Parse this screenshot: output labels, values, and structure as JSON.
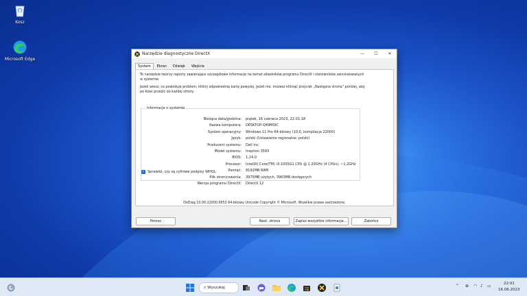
{
  "desktop": {
    "icons": [
      {
        "label": "Kosz"
      },
      {
        "label": "Microsoft Edge"
      }
    ]
  },
  "window": {
    "title": "Narzędzie diagnostyczne DirectX",
    "controls": {
      "minimize": "—",
      "maximize": "☐",
      "close": "✕"
    },
    "tabs": [
      {
        "label": "System",
        "active": true
      },
      {
        "label": "Ekran",
        "active": false
      },
      {
        "label": "Dźwięk",
        "active": false
      },
      {
        "label": "Wejście",
        "active": false
      }
    ],
    "intro_line1": "To narzędzie tworzy raporty zawierające szczegółowe informacje na temat składników programu DirectX i sterowników zainstalowanych w systemie.",
    "intro_line2": "Jeżeli wiesz, co powoduje problem, kliknij odpowiednią kartę powyżej. Jeżeli nie, możesz kliknąć przycisk „Następna strona” poniżej, aby po kolei przejść do każdej strony.",
    "group_title": "Informacje o systemie",
    "info": [
      {
        "key": "Bieżąca data/godzina:",
        "value": "piątek, 16 czerwca 2023, 22:01:18"
      },
      {
        "key": "Nazwa komputera:",
        "value": "DESKTOP-Q49MSIC"
      },
      {
        "key": "System operacyjny:",
        "value": "Windows 11 Pro 64-bitowy (10.0, kompilacja 22000)"
      },
      {
        "key": "Język:",
        "value": "polski (Ustawienie regionalne: polski)"
      },
      {
        "key": "Producent systemu:",
        "value": "Dell Inc."
      },
      {
        "key": "Model systemu:",
        "value": "Inspiron 3593"
      },
      {
        "key": "BIOS:",
        "value": "1.24.0"
      },
      {
        "key": "Procesor:",
        "value": "Intel(R) Core(TM) i3-1005G1 CPU @ 1.20GHz (4 CPUs), ~1.2GHz"
      },
      {
        "key": "Pamięć:",
        "value": "8192MB RAM"
      },
      {
        "key": "Plik stronicowania:",
        "value": "3975MB użytych, 3963MB dostępnych"
      },
      {
        "key": "Wersja programu DirectX:",
        "value": "DirectX 12"
      }
    ],
    "whql_label": "Sprawdź, czy są cyfrowe podpisy WHQL",
    "whql_checked": true,
    "footer": "DxDiag 10.00.22000.0653 64-bitowy Unicode  Copyright © Microsoft. Wszelkie prawa zastrzeżone.",
    "buttons": {
      "help": "Pomoc",
      "next": "Nast. strona",
      "save": "Zapisz wszystkie informacje...",
      "exit": "Zakończ"
    }
  },
  "taskbar": {
    "search_label": "Wyszukaj",
    "time": "22:01",
    "date": "16.06.2023",
    "tray_icons": [
      "chevron-up-icon",
      "language-icon",
      "wifi-icon",
      "speaker-icon",
      "battery-icon"
    ]
  },
  "colors": {
    "accent": "#1a6fd8",
    "taskbar": "#dfe8f5"
  }
}
